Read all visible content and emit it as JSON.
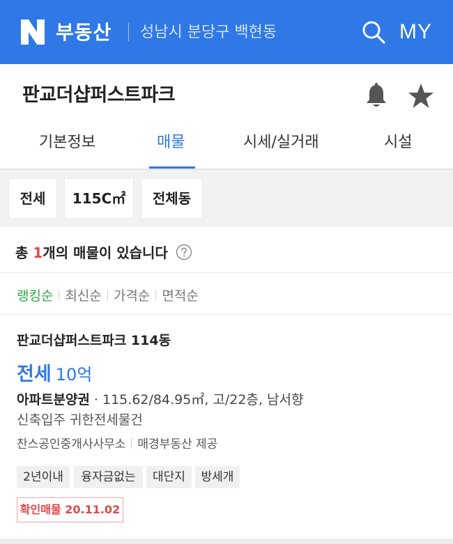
{
  "header": {
    "brand_label": "부동산",
    "region": "성남시 분당구 백현동",
    "my_label": "MY",
    "bg_color": "#2f78e6"
  },
  "complex": {
    "title": "판교더샵퍼스트파크"
  },
  "tabs": [
    {
      "label": "기본정보",
      "active": false
    },
    {
      "label": "매물",
      "active": true
    },
    {
      "label": "시세/실거래",
      "active": false
    },
    {
      "label": "시설",
      "active": false
    }
  ],
  "filters": [
    {
      "label": "전세"
    },
    {
      "label": "115C㎡"
    },
    {
      "label": "전체동"
    }
  ],
  "summary": {
    "prefix": "총 ",
    "count": "1",
    "suffix": "개의 매물이 있습니다"
  },
  "sort": [
    {
      "label": "랭킹순",
      "active": true
    },
    {
      "label": "최신순",
      "active": false
    },
    {
      "label": "가격순",
      "active": false
    },
    {
      "label": "면적순",
      "active": false
    }
  ],
  "listing": {
    "name": "판교더샵퍼스트파크 114동",
    "deal_type": "전세",
    "price": "10억",
    "property_type": "아파트분양권",
    "spec": " · 115.62/84.95㎡, 고/22층, 남서향",
    "description": "신축입주 귀한전세물건",
    "agent": "찬스공인중개사사무소",
    "provider": "매경부동산 제공",
    "tags": [
      "2년이내",
      "융자금없는",
      "대단지",
      "방세개"
    ],
    "verified": "확인매물 20.11.02"
  },
  "colors": {
    "accent": "#2f78e6",
    "count_red": "#e64545",
    "sort_active_green": "#2ea84c",
    "verified_red": "#e04848"
  }
}
